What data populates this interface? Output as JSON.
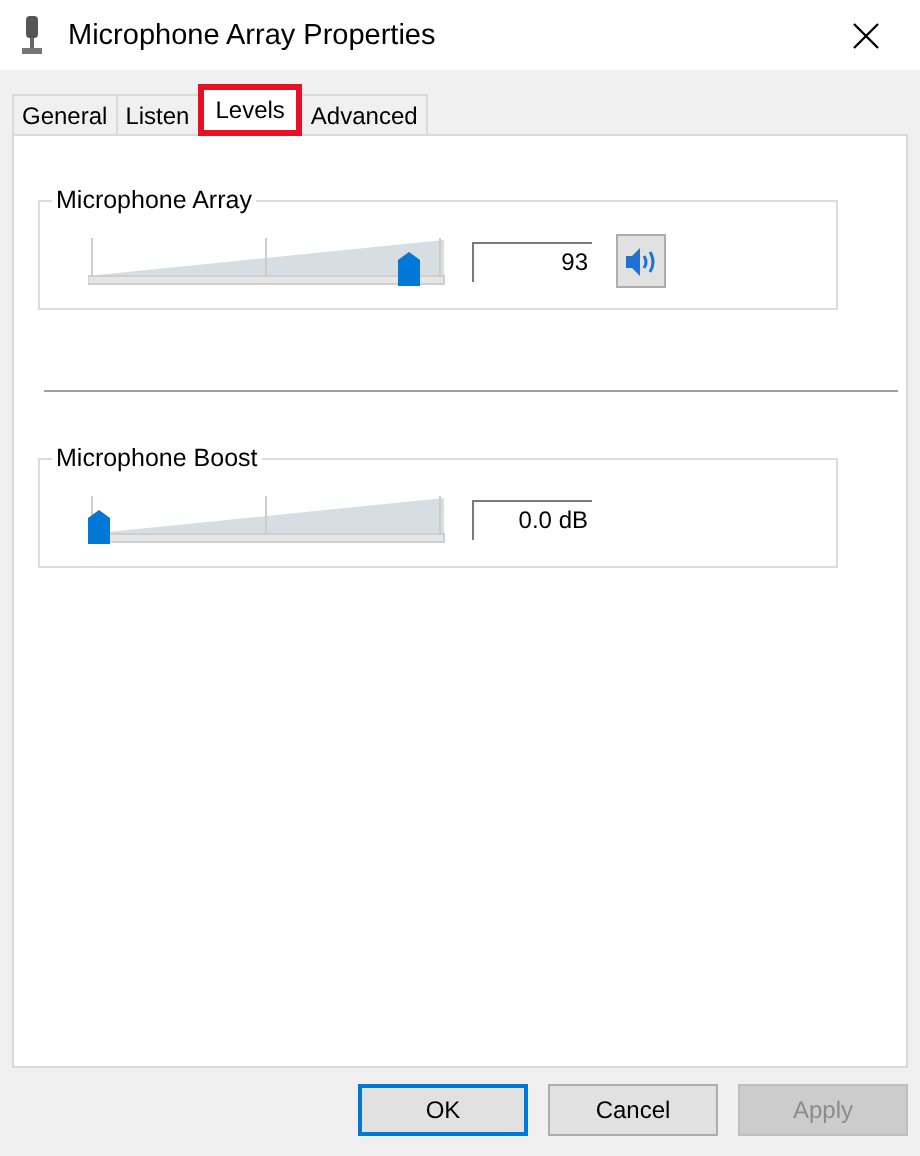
{
  "window": {
    "title": "Microphone Array Properties"
  },
  "tabs": [
    {
      "label": "General",
      "selected": false,
      "highlighted": false
    },
    {
      "label": "Listen",
      "selected": false,
      "highlighted": false
    },
    {
      "label": "Levels",
      "selected": true,
      "highlighted": true
    },
    {
      "label": "Advanced",
      "selected": false,
      "highlighted": false
    }
  ],
  "groups": [
    {
      "title": "Microphone Array",
      "level": 0.93,
      "value": "93",
      "mute_button": true
    },
    {
      "title": "Microphone Boost",
      "level": 0.0,
      "value": "0.0 dB",
      "mute_button": false
    }
  ],
  "buttons": [
    {
      "label": "OK",
      "default": true,
      "disabled": false
    },
    {
      "label": "Cancel",
      "default": false,
      "disabled": false
    },
    {
      "label": "Apply",
      "default": false,
      "disabled": true
    }
  ]
}
